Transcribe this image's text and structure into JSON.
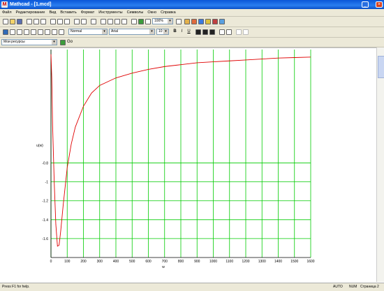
{
  "window": {
    "title": "Mathcad - [1.mcd]"
  },
  "menu": [
    "Файл",
    "Редактирование",
    "Вид",
    "Вставить",
    "Формат",
    "Инструменты",
    "Символы",
    "Окно",
    "Справка"
  ],
  "toolbar": {
    "zoom": "100%",
    "style": "Normal",
    "font": "Arial",
    "size": "10",
    "bold": "B",
    "italic": "I",
    "underline": "U",
    "resource": "Мои ресурсы",
    "go": "Go"
  },
  "chart_data": {
    "type": "line",
    "xlabel": "w",
    "ylabel": "u(w)",
    "xlim": [
      0,
      1600
    ],
    "ylim": [
      -1.8,
      0.4
    ],
    "xticks": [
      0,
      100,
      200,
      300,
      400,
      500,
      600,
      700,
      800,
      900,
      1000,
      1100,
      1200,
      1300,
      1400,
      1500,
      1600
    ],
    "yticks": [
      -1.6,
      -1.4,
      -1.2,
      -1,
      -0.8
    ],
    "ytick_labels": [
      "-1.6",
      "-1.4",
      "-1.2",
      "-1",
      "-0.8"
    ],
    "grid": true,
    "colors": {
      "line": "#e00000",
      "grid": "#00cc00"
    },
    "series": [
      {
        "x": [
          0,
          5,
          10,
          20,
          30,
          40,
          50,
          60,
          75,
          100,
          125,
          150,
          200,
          250,
          300,
          400,
          500,
          600,
          700,
          800,
          900,
          1000,
          1100,
          1200,
          1300,
          1400,
          1500,
          1600
        ],
        "values": [
          0.35,
          0.1,
          -0.4,
          -1.0,
          -1.45,
          -1.68,
          -1.67,
          -1.52,
          -1.25,
          -0.85,
          -0.6,
          -0.42,
          -0.2,
          -0.06,
          0.02,
          0.1,
          0.15,
          0.19,
          0.22,
          0.24,
          0.26,
          0.27,
          0.28,
          0.29,
          0.3,
          0.31,
          0.315,
          0.32
        ]
      }
    ]
  },
  "status": {
    "left": "Press F1 for help.",
    "auto": "AUTO",
    "num": "NUM",
    "page": "Страница 2"
  }
}
